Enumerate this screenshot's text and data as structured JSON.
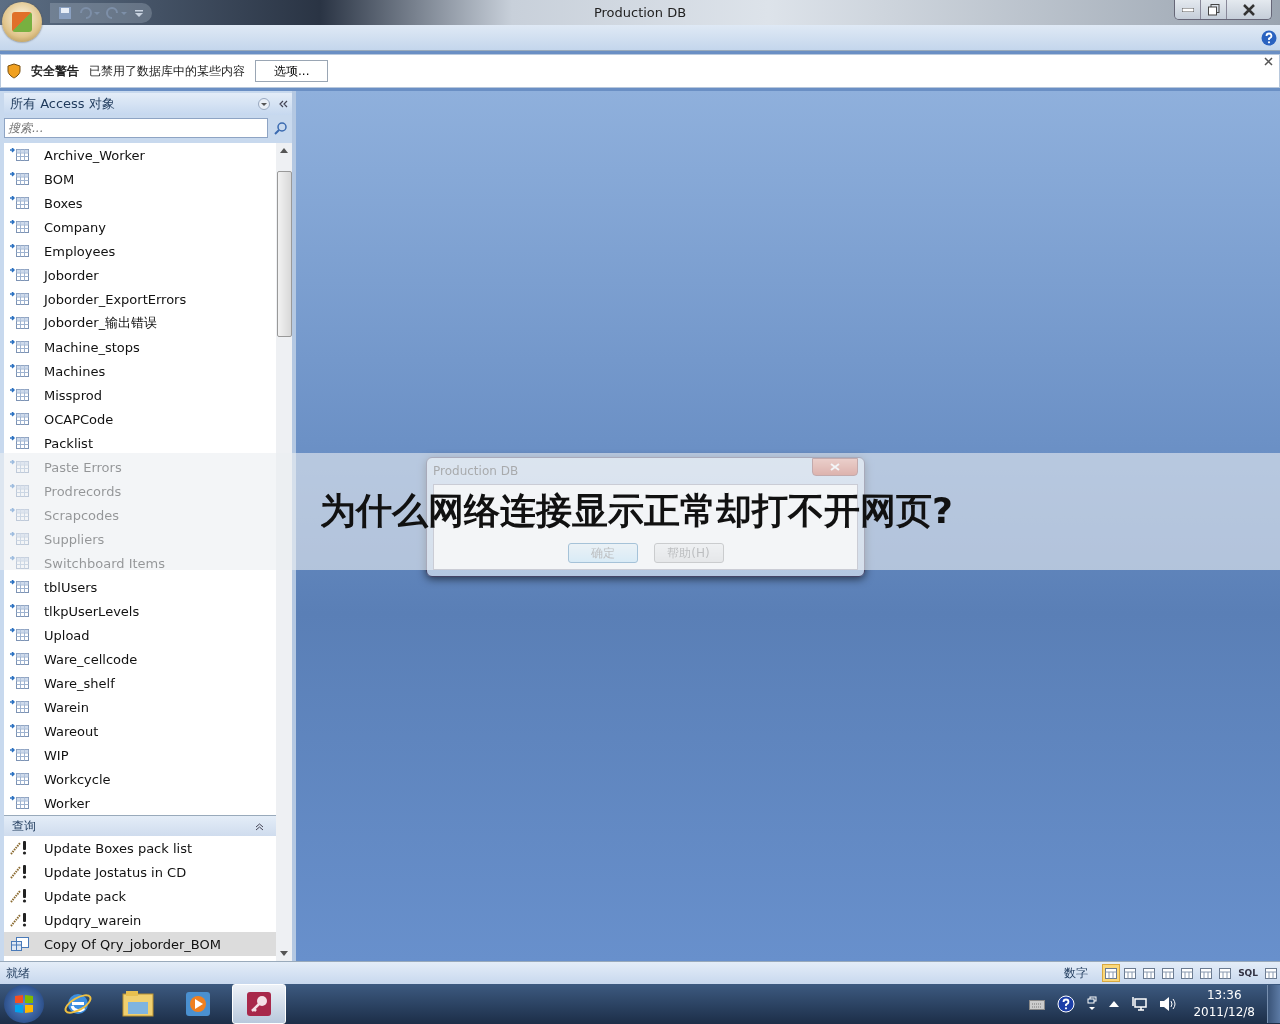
{
  "window": {
    "title": "Production DB"
  },
  "security_bar": {
    "title": "安全警告",
    "message": "已禁用了数据库中的某些内容",
    "button": "选项..."
  },
  "nav_pane": {
    "header": "所有 Access 对象",
    "search": {
      "placeholder": "搜索..."
    },
    "tables": [
      {
        "name": "Archive_Worker"
      },
      {
        "name": "BOM"
      },
      {
        "name": "Boxes"
      },
      {
        "name": "Company"
      },
      {
        "name": "Employees"
      },
      {
        "name": "Joborder"
      },
      {
        "name": "Joborder_ExportErrors"
      },
      {
        "name": "Joborder_输出错误"
      },
      {
        "name": "Machine_stops"
      },
      {
        "name": "Machines"
      },
      {
        "name": "Missprod"
      },
      {
        "name": "OCAPCode"
      },
      {
        "name": "Packlist"
      },
      {
        "name": "Paste Errors"
      },
      {
        "name": "Prodrecords"
      },
      {
        "name": "Scrapcodes"
      },
      {
        "name": "Suppliers"
      },
      {
        "name": "Switchboard Items"
      },
      {
        "name": "tblUsers"
      },
      {
        "name": "tlkpUserLevels"
      },
      {
        "name": "Upload"
      },
      {
        "name": "Ware_cellcode"
      },
      {
        "name": "Ware_shelf"
      },
      {
        "name": "Warein"
      },
      {
        "name": "Wareout"
      },
      {
        "name": "WIP"
      },
      {
        "name": "Workcycle"
      },
      {
        "name": "Worker"
      }
    ],
    "query_group": "查询",
    "queries": [
      {
        "name": "Update Boxes pack list",
        "kind": "action",
        "selected": false
      },
      {
        "name": "Update Jostatus in CD",
        "kind": "action",
        "selected": false
      },
      {
        "name": "Update pack",
        "kind": "action",
        "selected": false
      },
      {
        "name": "Updqry_warein",
        "kind": "action",
        "selected": false
      },
      {
        "name": "Copy Of Qry_joborder_BOM",
        "kind": "select",
        "selected": true
      }
    ]
  },
  "dialog": {
    "title": "Production DB",
    "buttons": [
      "确定",
      "帮助(H)"
    ]
  },
  "banner": {
    "text": "为什么网络连接显示正常却打不开网页?"
  },
  "status_bar": {
    "text": "就绪",
    "mode": "数字",
    "views": [
      {
        "kind": "icon",
        "selected": true
      },
      {
        "kind": "icon",
        "selected": false
      },
      {
        "kind": "icon",
        "selected": false
      },
      {
        "kind": "icon",
        "selected": false
      },
      {
        "kind": "icon",
        "selected": false
      },
      {
        "kind": "icon",
        "selected": false
      },
      {
        "kind": "icon",
        "selected": false
      },
      {
        "kind": "text",
        "label": "SQL",
        "selected": false
      },
      {
        "kind": "icon",
        "selected": false
      }
    ]
  },
  "taskbar": {
    "time": "13:36",
    "date": "2011/12/8"
  }
}
